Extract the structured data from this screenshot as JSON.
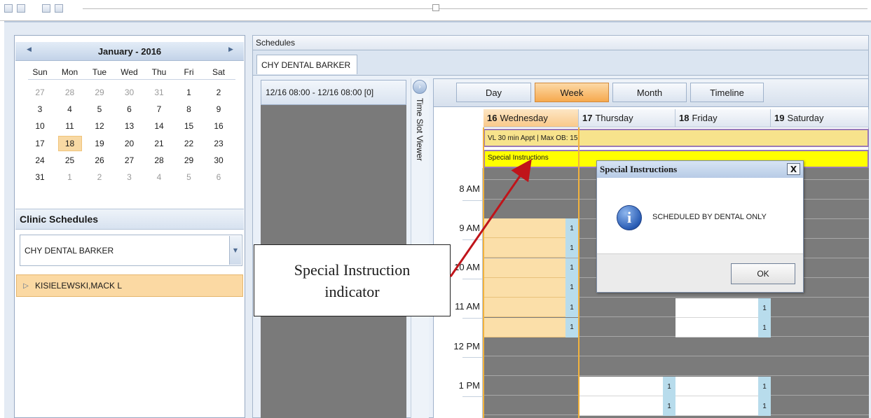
{
  "calendar": {
    "month_label": "January - 2016",
    "prev_icon": "chevron-left-icon",
    "next_icon": "chevron-right-icon",
    "weekdays": [
      "Sun",
      "Mon",
      "Tue",
      "Wed",
      "Thu",
      "Fri",
      "Sat"
    ],
    "weeks": [
      [
        "27",
        "28",
        "29",
        "30",
        "31",
        "1",
        "2"
      ],
      [
        "3",
        "4",
        "5",
        "6",
        "7",
        "8",
        "9"
      ],
      [
        "10",
        "11",
        "12",
        "13",
        "14",
        "15",
        "16"
      ],
      [
        "17",
        "18",
        "19",
        "20",
        "21",
        "22",
        "23"
      ],
      [
        "24",
        "25",
        "26",
        "27",
        "28",
        "29",
        "30"
      ],
      [
        "31",
        "1",
        "2",
        "3",
        "4",
        "5",
        "6"
      ]
    ],
    "selected_day": "18"
  },
  "clinic": {
    "heading": "Clinic Schedules",
    "selected_clinic": "CHY DENTAL BARKER",
    "provider": "KISIELEWSKI,MACK L"
  },
  "schedules": {
    "title": "Schedules",
    "tab_label": "CHY DENTAL BARKER",
    "time_slot_range": "12/16 08:00 - 12/16 08:00  [0]",
    "time_slot_viewer_label": "Time Slot Viewer",
    "views": [
      "Day",
      "Week",
      "Month",
      "Timeline"
    ],
    "active_view": "Week",
    "days": [
      {
        "num": "16",
        "name": "Wednesday"
      },
      {
        "num": "17",
        "name": "Thursday"
      },
      {
        "num": "18",
        "name": "Friday"
      },
      {
        "num": "19",
        "name": "Saturday"
      }
    ],
    "all_day_event_1": "VL 30 min Appt | Max OB: 15",
    "all_day_event_2": "Special Instructions",
    "time_labels": [
      "8 AM",
      "9 AM",
      "10 AM",
      "11 AM",
      "12 PM",
      "1 PM"
    ],
    "slot_indicator": "1"
  },
  "dialog": {
    "title": "Special Instructions",
    "close_label": "X",
    "message": "SCHEDULED BY DENTAL ONLY",
    "ok_label": "OK",
    "icon": "info-icon"
  },
  "callout": {
    "line1": "Special Instruction",
    "line2": "indicator"
  },
  "colors": {
    "accent_orange": "#f6a94e",
    "special_yellow": "#ffff00",
    "slot_orange": "#fbdfa9",
    "indicator_blue": "#b8dcec",
    "arrow_red": "#c0141a"
  }
}
